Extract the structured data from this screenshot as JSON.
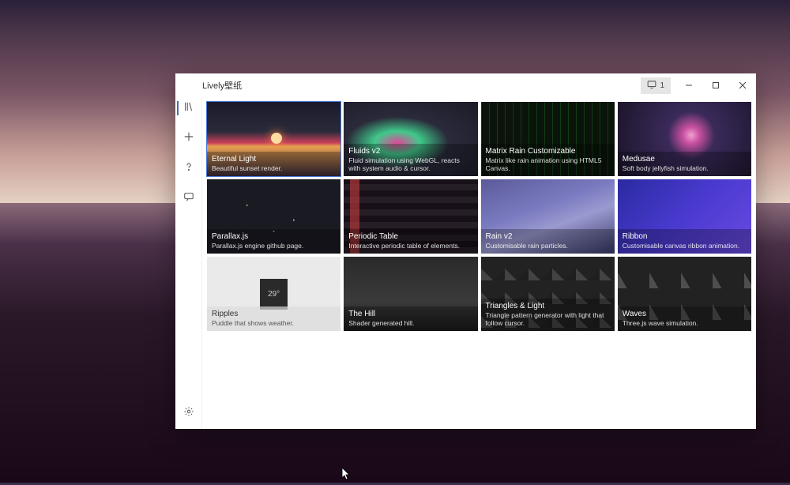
{
  "app": {
    "title": "Lively壁纸",
    "monitor_badge": "1"
  },
  "sidebar": {
    "items": [
      {
        "name": "library",
        "active": true
      },
      {
        "name": "add"
      },
      {
        "name": "help"
      },
      {
        "name": "feedback"
      }
    ],
    "footer": {
      "name": "settings"
    }
  },
  "wallpapers": [
    {
      "id": "eternal-light",
      "title": "Eternal Light",
      "desc": "Beautiful sunset render.",
      "thumb": "t-eternal",
      "selected": true
    },
    {
      "id": "fluids-v2",
      "title": "Fluids v2",
      "desc": "Fluid simulation using WebGL, reacts with system audio & cursor.",
      "thumb": "t-fluids"
    },
    {
      "id": "matrix-rain",
      "title": "Matrix Rain Customizable",
      "desc": "Matrix like rain animation using HTML5 Canvas.",
      "thumb": "t-matrix"
    },
    {
      "id": "medusae",
      "title": "Medusae",
      "desc": "Soft body jellyfish simulation.",
      "thumb": "t-medusae"
    },
    {
      "id": "parallax-js",
      "title": "Parallax.js",
      "desc": "Parallax.js engine github page.",
      "thumb": "t-parallax"
    },
    {
      "id": "periodic-table",
      "title": "Periodic Table",
      "desc": "Interactive periodic table of elements.",
      "thumb": "t-periodic"
    },
    {
      "id": "rain-v2",
      "title": "Rain v2",
      "desc": "Customisable rain particles.",
      "thumb": "t-rain"
    },
    {
      "id": "ribbon",
      "title": "Ribbon",
      "desc": "Customisable canvas ribbon animation.",
      "thumb": "t-ribbon"
    },
    {
      "id": "ripples",
      "title": "Ripples",
      "desc": "Puddle that shows weather.",
      "thumb": "t-ripples",
      "light": true
    },
    {
      "id": "the-hill",
      "title": "The Hill",
      "desc": "Shader generated hill.",
      "thumb": "t-hill"
    },
    {
      "id": "triangles-light",
      "title": "Triangles & Light",
      "desc": "Triangle pattern generator with light that follow cursor.",
      "thumb": "t-triangles"
    },
    {
      "id": "waves",
      "title": "Waves",
      "desc": "Three.js wave simulation.",
      "thumb": "t-waves"
    }
  ]
}
